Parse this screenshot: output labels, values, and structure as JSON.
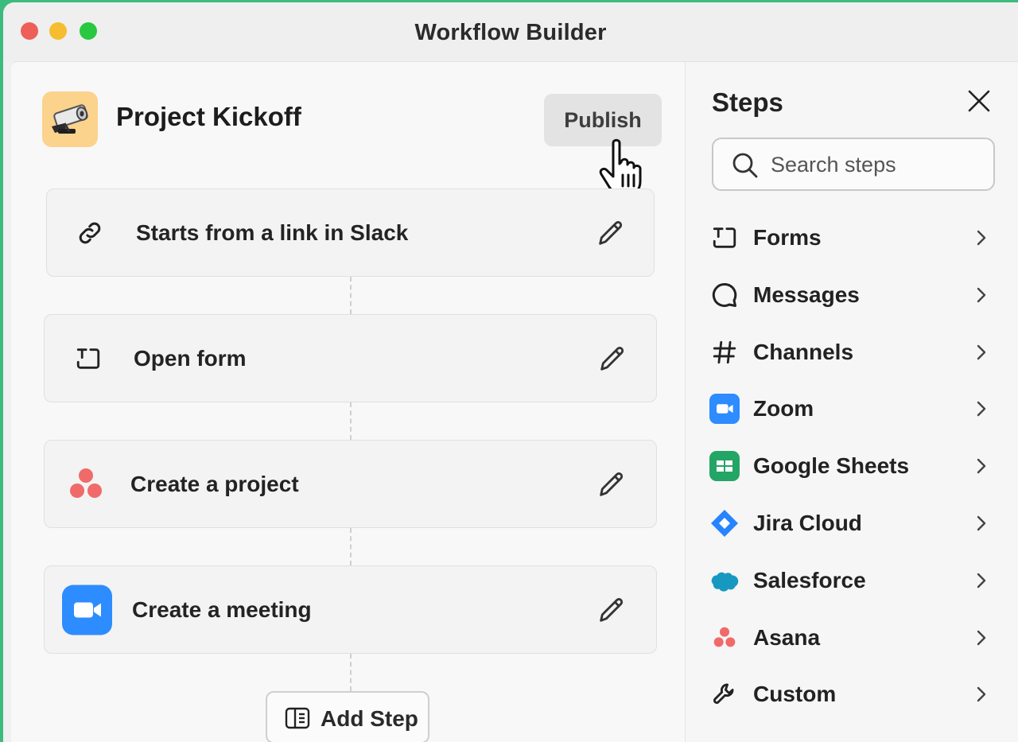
{
  "window": {
    "title": "Workflow Builder"
  },
  "workflow": {
    "name": "Project Kickoff",
    "publish_label": "Publish",
    "steps": [
      {
        "label": "Starts from a link in Slack",
        "icon": "link-icon"
      },
      {
        "label": "Open form",
        "icon": "form-icon"
      },
      {
        "label": "Create a project",
        "icon": "asana-icon"
      },
      {
        "label": "Create a meeting",
        "icon": "zoom-icon"
      }
    ],
    "add_step_label": "Add Step"
  },
  "panel": {
    "title": "Steps",
    "search_placeholder": "Search steps",
    "categories": [
      {
        "label": "Forms",
        "icon": "form-icon"
      },
      {
        "label": "Messages",
        "icon": "message-icon"
      },
      {
        "label": "Channels",
        "icon": "hash-icon"
      },
      {
        "label": "Zoom",
        "icon": "zoom-icon"
      },
      {
        "label": "Google Sheets",
        "icon": "google-sheets-icon"
      },
      {
        "label": "Jira Cloud",
        "icon": "jira-icon"
      },
      {
        "label": "Salesforce",
        "icon": "salesforce-icon"
      },
      {
        "label": "Asana",
        "icon": "asana-icon"
      },
      {
        "label": "Custom",
        "icon": "wrench-icon"
      }
    ]
  },
  "colors": {
    "background_green": "#3dbb7f",
    "zoom_blue": "#2d8cff",
    "sheets_green": "#23a566",
    "jira_blue": "#2684ff",
    "salesforce_blue": "#1798c1",
    "asana_coral": "#f06a6a",
    "project_icon_bg": "#fcd38c"
  }
}
